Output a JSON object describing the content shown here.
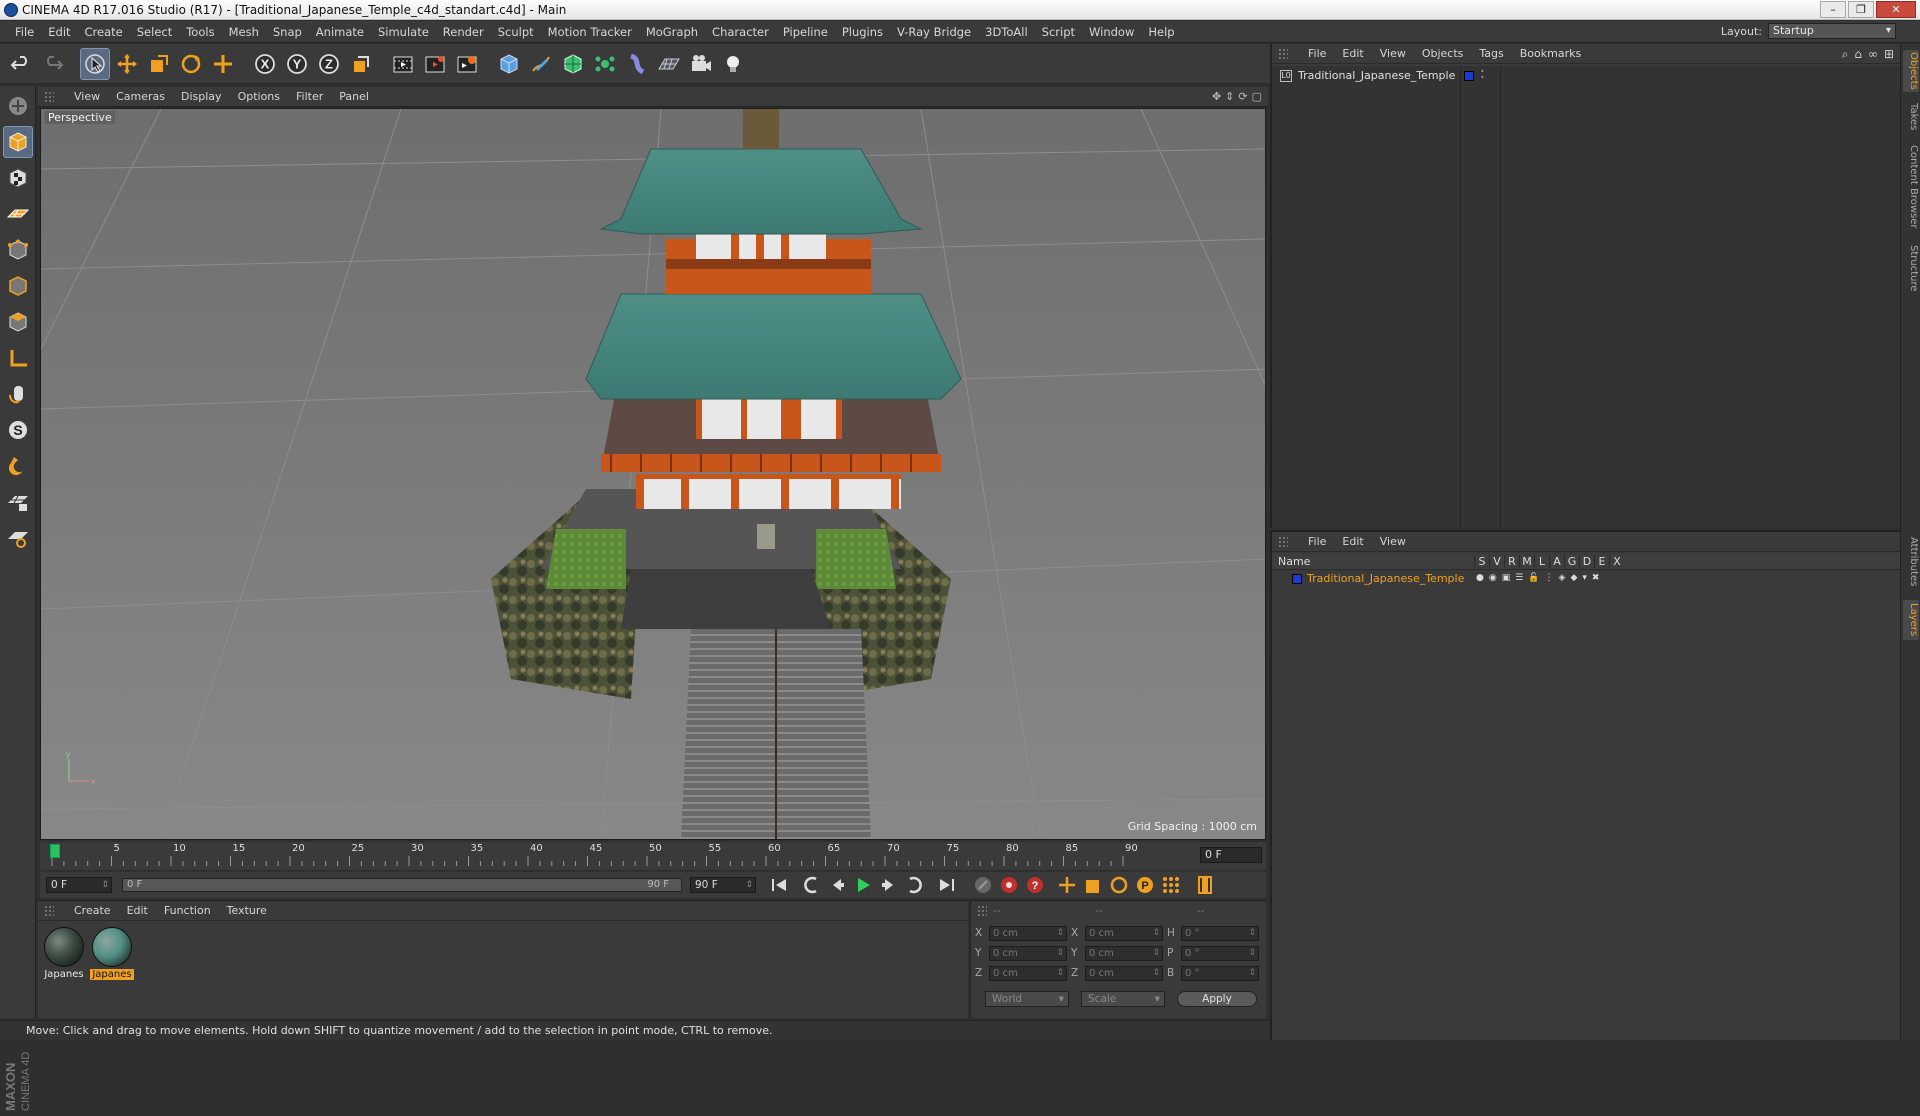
{
  "window": {
    "title": "CINEMA 4D R17.016 Studio (R17) - [Traditional_Japanese_Temple_c4d_standart.c4d] - Main",
    "buttons": [
      "–",
      "❐",
      "✕"
    ]
  },
  "menubar": {
    "items": [
      "File",
      "Edit",
      "Create",
      "Select",
      "Tools",
      "Mesh",
      "Snap",
      "Animate",
      "Simulate",
      "Render",
      "Sculpt",
      "Motion Tracker",
      "MoGraph",
      "Character",
      "Pipeline",
      "Plugins",
      "V-Ray Bridge",
      "3DToAll",
      "Script",
      "Window",
      "Help"
    ],
    "layout_label": "Layout:",
    "layout_value": "Startup"
  },
  "toolbar": {
    "icons": [
      "undo-icon",
      "redo-icon",
      "live-select-icon",
      "move-icon",
      "scale-icon",
      "rotate-icon",
      "add-object-icon",
      "x-axis-icon",
      "y-axis-icon",
      "z-axis-icon",
      "coordinate-system-icon",
      "render-view-icon",
      "render-picture-viewer-icon",
      "render-settings-icon",
      "cube-icon",
      "pen-icon",
      "subdivision-icon",
      "mograph-cloner-icon",
      "deformer-icon",
      "floor-icon",
      "camera-icon",
      "light-icon"
    ]
  },
  "viewport": {
    "menu": [
      "View",
      "Cameras",
      "Display",
      "Options",
      "Filter",
      "Panel"
    ],
    "label": "Perspective",
    "grid_spacing": "Grid Spacing : 1000 cm"
  },
  "timeline": {
    "ticks": [
      "0",
      "5",
      "10",
      "15",
      "20",
      "25",
      "30",
      "35",
      "40",
      "45",
      "50",
      "55",
      "60",
      "65",
      "70",
      "75",
      "80",
      "85",
      "90"
    ],
    "current_frame": "0 F",
    "start_field": "0 F",
    "range_start": "0 F",
    "range_end": "90 F",
    "end_field": "90 F"
  },
  "materials": {
    "menu": [
      "Create",
      "Edit",
      "Function",
      "Texture"
    ],
    "items": [
      {
        "label": "Japanes",
        "selected": false
      },
      {
        "label": "Japanes",
        "selected": true
      }
    ]
  },
  "coordinates": {
    "header": [
      "--",
      "--",
      "--"
    ],
    "rows": [
      {
        "a": "X",
        "av": "0 cm",
        "b": "X",
        "bv": "0 cm",
        "c": "H",
        "cv": "0 °"
      },
      {
        "a": "Y",
        "av": "0 cm",
        "b": "Y",
        "bv": "0 cm",
        "c": "P",
        "cv": "0 °"
      },
      {
        "a": "Z",
        "av": "0 cm",
        "b": "Z",
        "bv": "0 cm",
        "c": "B",
        "cv": "0 °"
      }
    ],
    "mode1": "World",
    "mode2": "Scale",
    "apply": "Apply"
  },
  "status": {
    "text": "Move: Click and drag to move elements. Hold down SHIFT to quantize movement / add to the selection in point mode, CTRL to remove."
  },
  "objects_panel": {
    "menu": [
      "File",
      "Edit",
      "View",
      "Objects",
      "Tags",
      "Bookmarks"
    ],
    "object_name": "Traditional_Japanese_Temple",
    "layer_color": "#1b3dcf"
  },
  "layers_panel": {
    "menu": [
      "File",
      "Edit",
      "View"
    ],
    "header_name": "Name",
    "flags": [
      "S",
      "V",
      "R",
      "M",
      "L",
      "A",
      "G",
      "D",
      "E",
      "X"
    ],
    "layer_name": "Traditional_Japanese_Temple",
    "layer_color": "#1b3dcf"
  },
  "right_tabs": [
    "Objects",
    "Takes",
    "Content Browser",
    "Structure",
    "Attributes",
    "Layers"
  ],
  "colors": {
    "accent": "#f0a020",
    "roof": "#4f8f86",
    "wood": "#c8561a",
    "grass": "#5d8a36"
  }
}
